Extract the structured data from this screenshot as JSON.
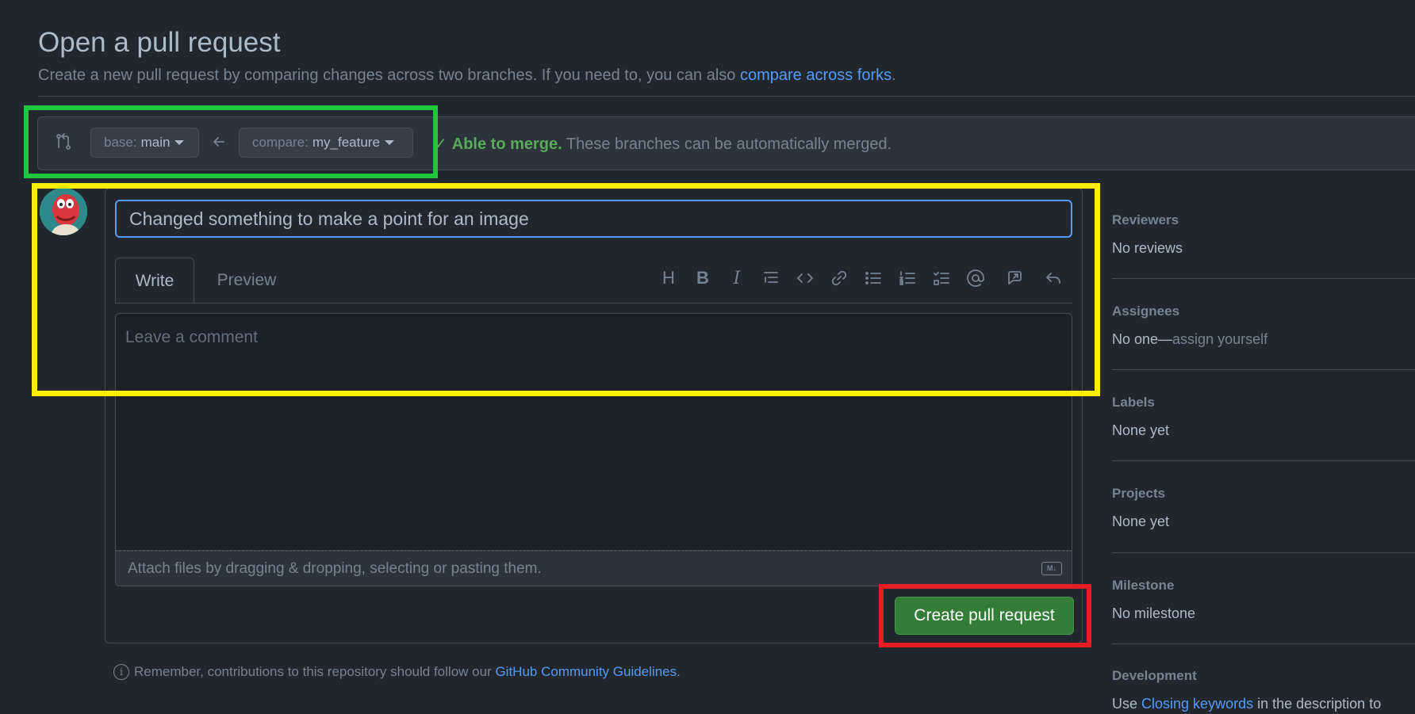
{
  "header": {
    "title": "Open a pull request",
    "subtitle": "Create a new pull request by comparing changes across two branches. If you need to, you can also",
    "subtitle_link": "compare across forks",
    "subtitle_end": "."
  },
  "compare": {
    "base_key": "base:",
    "base_value": "main",
    "compare_key": "compare:",
    "compare_value": "my_feature",
    "merge_ok": "Able to merge.",
    "merge_text": "These branches can be automatically merged."
  },
  "form": {
    "title_value": "Changed something to make a point for an image",
    "tab_write": "Write",
    "tab_preview": "Preview",
    "comment_placeholder": "Leave a comment",
    "attach_text": "Attach files by dragging & dropping, selecting or pasting them.",
    "markdown_badge": "M↓",
    "submit_label": "Create pull request",
    "toolbar": [
      "heading-icon",
      "bold-icon",
      "italic-icon",
      "quote-icon",
      "code-icon",
      "link-icon",
      "unordered-list-icon",
      "ordered-list-icon",
      "task-list-icon",
      "mention-icon",
      "reference-icon",
      "undo-icon"
    ]
  },
  "note": {
    "text": "Remember, contributions to this repository should follow our",
    "link": "GitHub Community Guidelines",
    "end": "."
  },
  "sidebar": {
    "reviewers": {
      "label": "Reviewers",
      "value": "No reviews"
    },
    "assignees": {
      "label": "Assignees",
      "value": "No one—",
      "action": "assign yourself"
    },
    "labels": {
      "label": "Labels",
      "value": "None yet"
    },
    "projects": {
      "label": "Projects",
      "value": "None yet"
    },
    "milestone": {
      "label": "Milestone",
      "value": "No milestone"
    },
    "development": {
      "label": "Development",
      "value_start": "Use",
      "link": "Closing keywords",
      "value_end": "in the description to"
    }
  },
  "colors": {
    "background": "#22272e",
    "accent_link": "#539bf5",
    "success": "#57ab5a",
    "primary_button": "#347d39",
    "highlight_green": "#1dc83a",
    "highlight_yellow": "#ffee00",
    "highlight_red": "#e81c24"
  }
}
